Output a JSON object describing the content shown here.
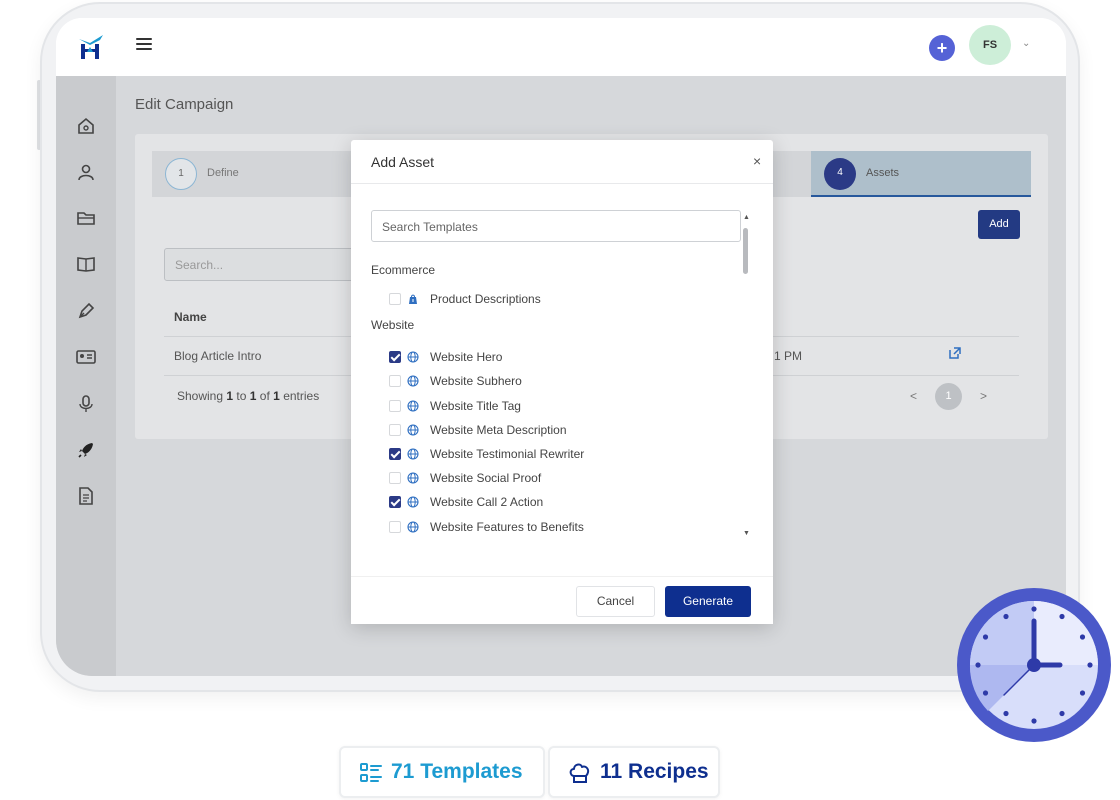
{
  "topbar": {
    "logo_icon": "hm-logo-icon",
    "menu_icon": "hamburger-icon",
    "plus_label": "+",
    "avatar_initials": "FS",
    "dropdown_glyph": "⌄",
    "accent_color": "#5562d6"
  },
  "sidebar": {
    "items": [
      {
        "icon": "home-icon"
      },
      {
        "icon": "user-icon"
      },
      {
        "icon": "folder-icon"
      },
      {
        "icon": "book-icon"
      },
      {
        "icon": "pen-icon"
      },
      {
        "icon": "id-card-icon"
      },
      {
        "icon": "microphone-icon"
      },
      {
        "icon": "rocket-icon"
      },
      {
        "icon": "document-icon"
      }
    ]
  },
  "page": {
    "title": "Edit Campaign",
    "steps": [
      {
        "number": "1",
        "label": "Define"
      },
      {
        "number": "4",
        "label": "Assets"
      }
    ],
    "add_label": "Add",
    "search_placeholder": "Search...",
    "table": {
      "column_name": "Name",
      "row": {
        "name": "Blog Article Intro",
        "time_fragment": "1 PM"
      }
    },
    "showing": {
      "prefix": "Showing",
      "from": "1",
      "to_word": "to",
      "to": "1",
      "of_word": "of",
      "total": "1",
      "suffix": "entries"
    },
    "pager": {
      "prev": "<",
      "page": "1",
      "next": ">"
    }
  },
  "modal": {
    "title": "Add Asset",
    "close_glyph": "×",
    "search_placeholder": "Search Templates",
    "groups": [
      {
        "name": "Ecommerce",
        "items": [
          {
            "label": "Product Descriptions",
            "checked": false,
            "icon": "shopify-bag-icon"
          }
        ]
      },
      {
        "name": "Website",
        "items": [
          {
            "label": "Website Hero",
            "checked": true,
            "icon": "globe-icon"
          },
          {
            "label": "Website Subhero",
            "checked": false,
            "icon": "globe-icon"
          },
          {
            "label": "Website Title Tag",
            "checked": false,
            "icon": "globe-icon"
          },
          {
            "label": "Website Meta Description",
            "checked": false,
            "icon": "globe-icon"
          },
          {
            "label": "Website Testimonial Rewriter",
            "checked": true,
            "icon": "globe-icon"
          },
          {
            "label": "Website Social Proof",
            "checked": false,
            "icon": "globe-icon"
          },
          {
            "label": "Website Call 2 Action",
            "checked": true,
            "icon": "globe-icon"
          },
          {
            "label": "Website Features to Benefits",
            "checked": false,
            "icon": "globe-icon"
          }
        ]
      }
    ],
    "cancel_label": "Cancel",
    "generate_label": "Generate",
    "primary_color": "#0e2f8f"
  },
  "badges": [
    {
      "label": "71 Templates",
      "icon": "template-list-icon",
      "color": "#1d9bd1"
    },
    {
      "label": "11 Recipes",
      "icon": "chef-hat-icon",
      "color": "#0e2f8f"
    }
  ],
  "decor": {
    "clock_icon": "clock-icon"
  }
}
